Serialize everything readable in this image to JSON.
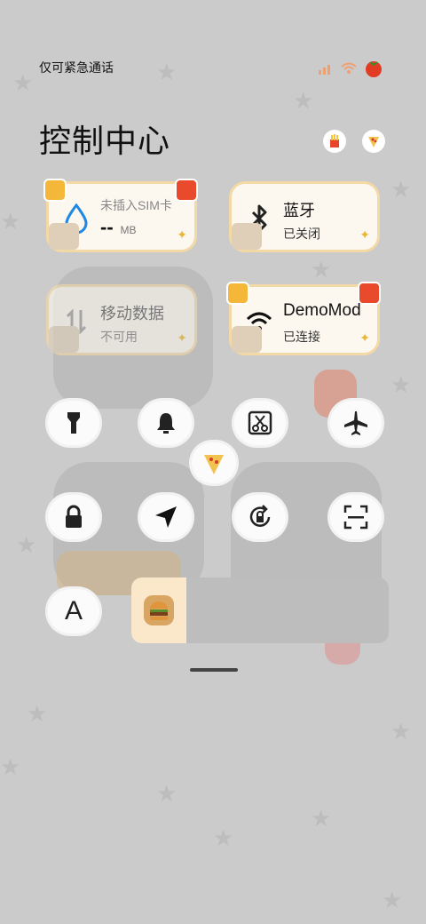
{
  "status": {
    "carrier_text": "仅可紧急通话"
  },
  "header": {
    "title": "控制中心"
  },
  "tiles": {
    "data_usage": {
      "label": "未插入SIM卡",
      "value": "--",
      "unit": "MB"
    },
    "bluetooth": {
      "label": "蓝牙",
      "status": "已关闭"
    },
    "mobile_data": {
      "label": "移动数据",
      "status": "不可用"
    },
    "wifi": {
      "label": "DemoMod",
      "status": "已连接"
    }
  },
  "buttons": [
    "flashlight",
    "notification-bell",
    "screenshot",
    "airplane-mode",
    "lock-screen",
    "location",
    "auto-rotate",
    "scan",
    "font-size"
  ],
  "font_button_label": "A",
  "colors": {
    "background": "#cbcbcb",
    "tile_bg": "#fffaf0",
    "tile_border": "#f2d9a6",
    "accent_blue": "#1e88e5"
  }
}
